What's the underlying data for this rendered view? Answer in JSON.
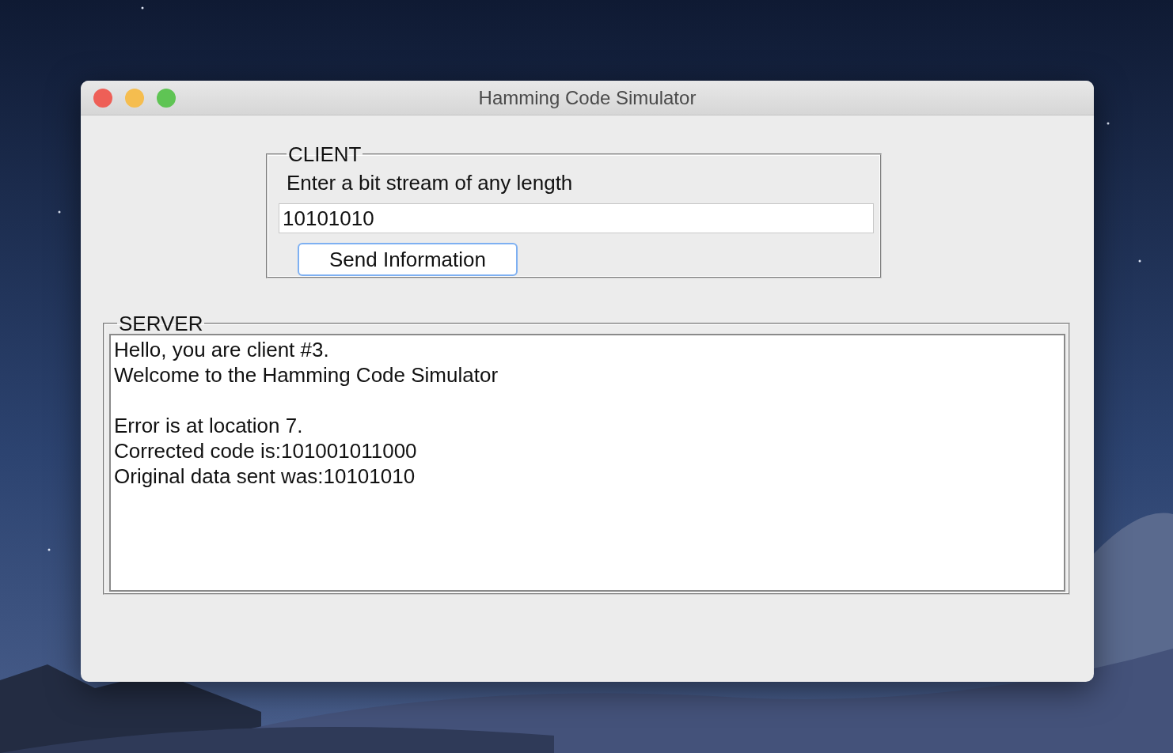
{
  "window": {
    "title": "Hamming Code Simulator"
  },
  "client": {
    "title": "CLIENT",
    "prompt": "Enter a bit stream of any length",
    "input_value": "10101010",
    "button": "Send Information"
  },
  "server": {
    "title": "SERVER",
    "message_groups": [
      [
        "Hello, you are client #3.",
        "Welcome to the Hamming Code Simulator"
      ],
      [
        "Error is at location 7.",
        "Corrected code is:101001011000",
        "Original data sent was:10101010"
      ]
    ]
  }
}
